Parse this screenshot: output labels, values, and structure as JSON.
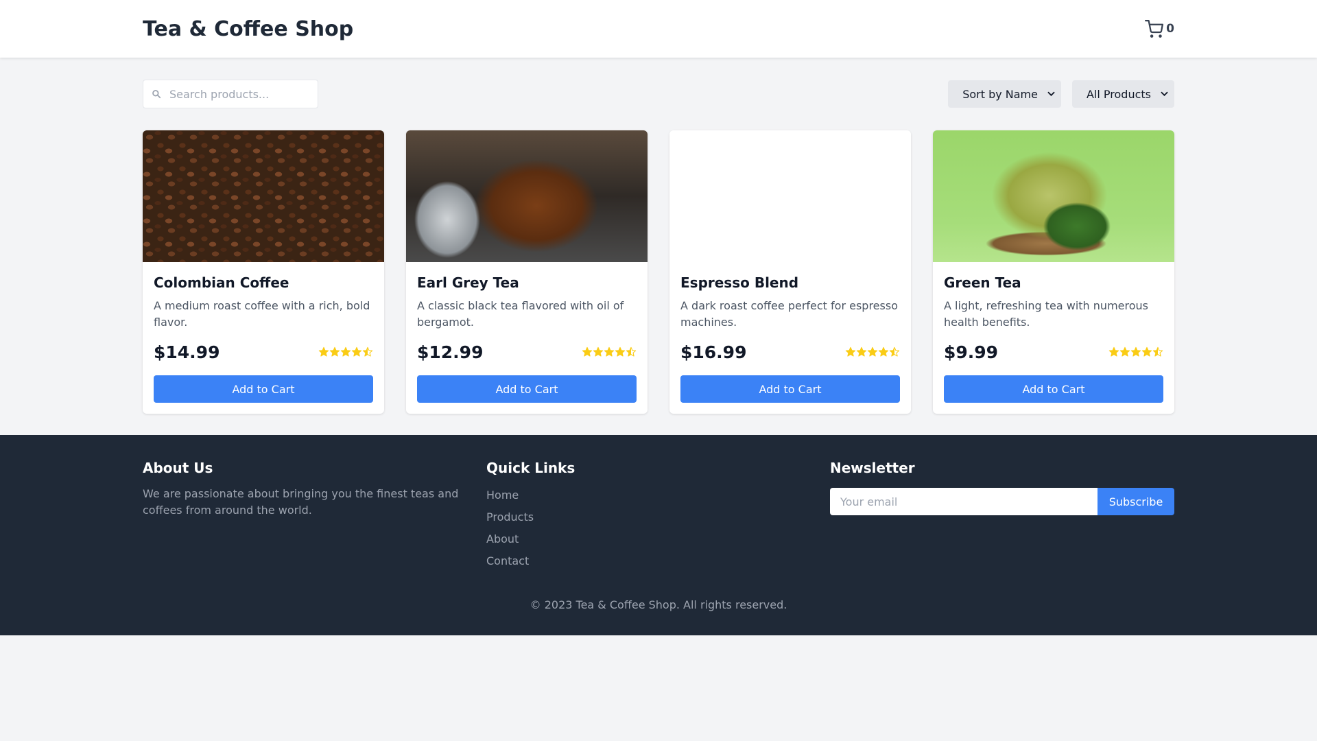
{
  "header": {
    "title": "Tea & Coffee Shop",
    "cart_count": "0",
    "cart_icon": "shopping-cart-icon"
  },
  "toolbar": {
    "search_placeholder": "Search products...",
    "search_value": "",
    "sort_selected": "Sort by Name",
    "filter_selected": "All Products"
  },
  "products": [
    {
      "name": "Colombian Coffee",
      "description": "A medium roast coffee with a rich, bold flavor.",
      "price": "$14.99",
      "rating": 4.5,
      "image": "coffee-beans",
      "cta": "Add to Cart"
    },
    {
      "name": "Earl Grey Tea",
      "description": "A classic black tea flavored with oil of bergamot.",
      "price": "$12.99",
      "rating": 4.5,
      "image": "earl-grey-cup",
      "cta": "Add to Cart"
    },
    {
      "name": "Espresso Blend",
      "description": "A dark roast coffee perfect for espresso machines.",
      "price": "$16.99",
      "rating": 4.5,
      "image": "blank",
      "cta": "Add to Cart"
    },
    {
      "name": "Green Tea",
      "description": "A light, refreshing tea with numerous health benefits.",
      "price": "$9.99",
      "rating": 4.5,
      "image": "green-tea-cup",
      "cta": "Add to Cart"
    }
  ],
  "footer": {
    "about_title": "About Us",
    "about_text": "We are passionate about bringing you the finest teas and coffees from around the world.",
    "links_title": "Quick Links",
    "links": [
      "Home",
      "Products",
      "About",
      "Contact"
    ],
    "newsletter_title": "Newsletter",
    "newsletter_placeholder": "Your email",
    "subscribe_label": "Subscribe",
    "copyright": "© 2023 Tea & Coffee Shop. All rights reserved."
  },
  "colors": {
    "primary": "#3b82f6",
    "star": "#facc15",
    "footer_bg": "#1f2937",
    "page_bg": "#f3f4f6"
  }
}
